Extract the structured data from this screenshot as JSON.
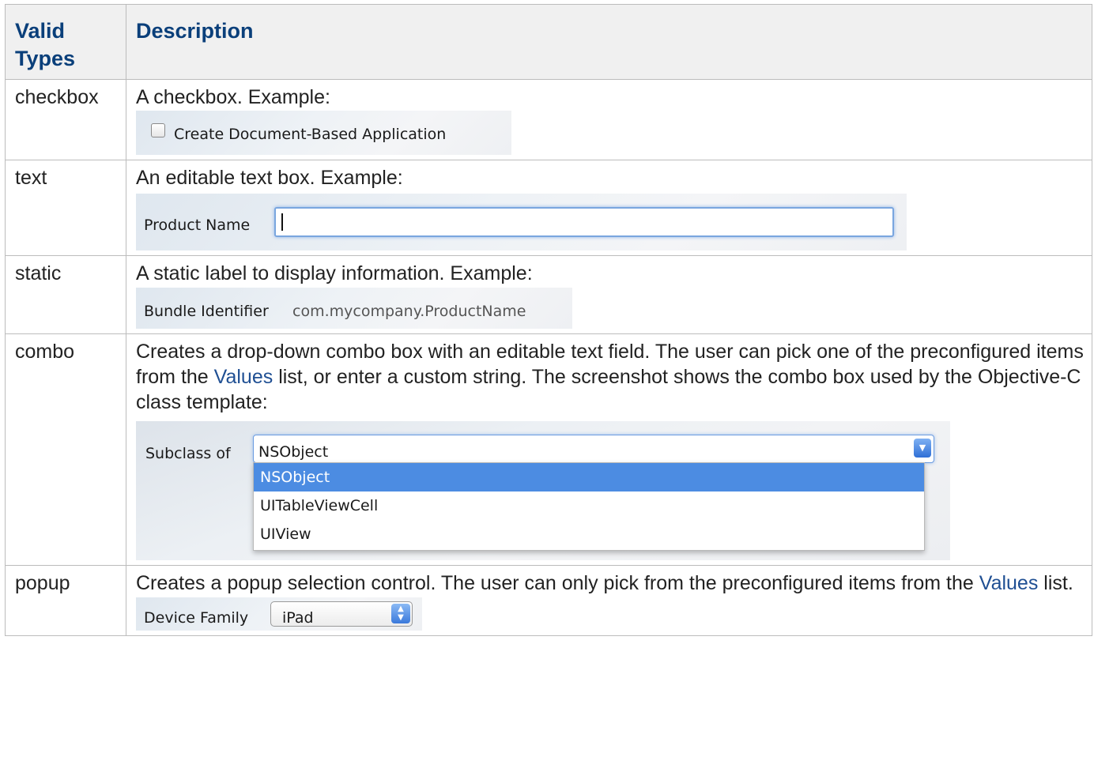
{
  "table": {
    "headers": {
      "types": "Valid Types",
      "description": "Description"
    },
    "rows": [
      {
        "type": "checkbox",
        "description": "A checkbox. Example:"
      },
      {
        "type": "text",
        "description": "An editable text box. Example:"
      },
      {
        "type": "static",
        "description": "A static label to display information. Example:"
      },
      {
        "type": "combo",
        "description_before_link": "Creates a drop-down combo box with an editable text field. The user can pick one of the preconfigured items from the ",
        "link": "Values",
        "description_after_link": " list, or enter a custom string. The screenshot shows the combo box used by the Objective-C class template:"
      },
      {
        "type": "popup",
        "description_before_link": "Creates a popup selection control. The user can only pick from the preconfigured items from the ",
        "link": "Values",
        "description_after_link": " list."
      }
    ]
  },
  "examples": {
    "checkbox": {
      "label": "Create Document-Based Application",
      "checked": false
    },
    "text": {
      "label": "Product Name",
      "value": ""
    },
    "static": {
      "label": "Bundle Identifier",
      "value": "com.mycompany.ProductName"
    },
    "combo": {
      "label": "Subclass of",
      "value": "NSObject",
      "options": [
        "NSObject",
        "UITableViewCell",
        "UIView"
      ],
      "selected_index": 0
    },
    "popup": {
      "label": "Device Family",
      "value": "iPad"
    }
  },
  "colors": {
    "header_text": "#0a3f7a",
    "header_bg": "#f0f0f0",
    "link": "#1f4f93",
    "selection": "#4c8ce2"
  }
}
